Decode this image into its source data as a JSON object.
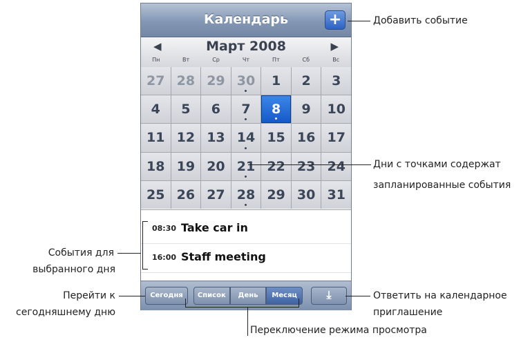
{
  "header": {
    "title": "Календарь",
    "add_label": "+"
  },
  "month_bar": {
    "prev": "◀",
    "next": "▶",
    "month": "Март 2008",
    "weekdays": [
      "Пн",
      "Вт",
      "Ср",
      "Чт",
      "Пт",
      "Сб",
      "Вс"
    ]
  },
  "calendar": {
    "weeks": [
      [
        "27",
        "28",
        "29",
        "30",
        "1",
        "2",
        "3"
      ],
      [
        "4",
        "5",
        "6",
        "7",
        "8",
        "9",
        "10"
      ],
      [
        "11",
        "12",
        "13",
        "14",
        "15",
        "16",
        "17"
      ],
      [
        "18",
        "19",
        "20",
        "21",
        "22",
        "23",
        "24"
      ],
      [
        "25",
        "26",
        "27",
        "28",
        "29",
        "30",
        "31"
      ]
    ]
  },
  "events": [
    {
      "time": "08:30",
      "title": "Take car in"
    },
    {
      "time": "16:00",
      "title": "Staff meeting"
    }
  ],
  "toolbar": {
    "today": "Сегодня",
    "list": "Список",
    "day": "День",
    "month": "Месяц",
    "inbox_icon": "⤓"
  },
  "callouts": {
    "add_event": "Добавить событие",
    "dots_line1": "Дни с точками содержат",
    "dots_line2": "запланированные события",
    "events_line1": "События для",
    "events_line2": "выбранного дня",
    "today_line1": "Перейти к",
    "today_line2": "сегодняшнему дню",
    "reply_line1": "Ответить на календарное",
    "reply_line2": "приглашение",
    "switch_view": "Переключение режима просмотра"
  }
}
